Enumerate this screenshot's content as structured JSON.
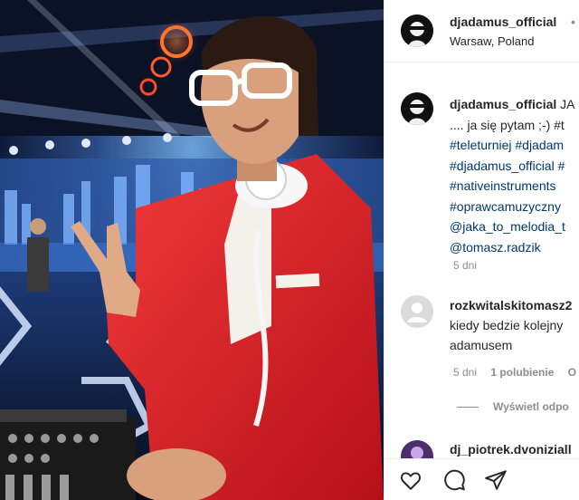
{
  "post": {
    "author": "djadamus_official",
    "location": "Warsaw, Poland",
    "dot": "•",
    "caption_lines": [
      {
        "text": "djadamus_official JA",
        "type": "mixed"
      },
      {
        "text": ".... ja się pytam ;-) #t",
        "type": "text"
      },
      {
        "text": "#teleturniej #djadam",
        "type": "tag"
      },
      {
        "text": "#djadamus_official #",
        "type": "tag"
      },
      {
        "text": "#nativeinstruments ",
        "type": "tag"
      },
      {
        "text": "#oprawcamuzyczny",
        "type": "tag"
      },
      {
        "text": "@jaka_to_melodia_t",
        "type": "tag"
      },
      {
        "text": "@tomasz.radzik",
        "type": "tag"
      }
    ],
    "caption_username": "djadamus_official",
    "caption_first_rest": " JA",
    "time": "5 dni"
  },
  "comments": [
    {
      "username": "rozkwitalskitomasz2",
      "text_lines": [
        "kiedy bedzie kolejny",
        "adamusem"
      ],
      "time": "5 dni",
      "likes": "1 polubienie",
      "reply_cut": "O",
      "view_replies": "Wyświetl odpo"
    },
    {
      "username": "dj_piotrek.dvoniziall"
    }
  ],
  "icons": {
    "like": "heart-icon",
    "comment": "comment-icon",
    "share": "share-icon"
  },
  "colors": {
    "jacket": "#e0242a",
    "link": "#00376b",
    "muted": "#8e8e8e"
  }
}
